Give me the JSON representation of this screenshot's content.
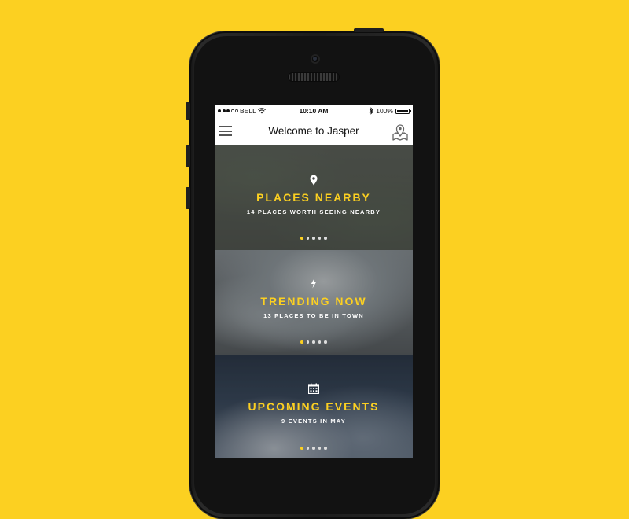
{
  "status_bar": {
    "carrier": "BELL",
    "time": "10:10 AM",
    "battery": "100%"
  },
  "navbar": {
    "title": "Welcome to Jasper"
  },
  "cards": [
    {
      "title": "PLACES NEARBY",
      "subtitle": "14 PLACES WORTH SEEING NEARBY",
      "icon": "location-pin-icon",
      "page_active": 1,
      "page_count": 5
    },
    {
      "title": "TRENDING NOW",
      "subtitle": "13 PLACES TO BE IN TOWN",
      "icon": "lightning-bolt-icon",
      "page_active": 1,
      "page_count": 5
    },
    {
      "title": "UPCOMING EVENTS",
      "subtitle": "9 EVENTS IN MAY",
      "icon": "calendar-icon",
      "page_active": 1,
      "page_count": 5
    }
  ],
  "colors": {
    "background": "#FCD021",
    "accent": "#FCD021"
  }
}
